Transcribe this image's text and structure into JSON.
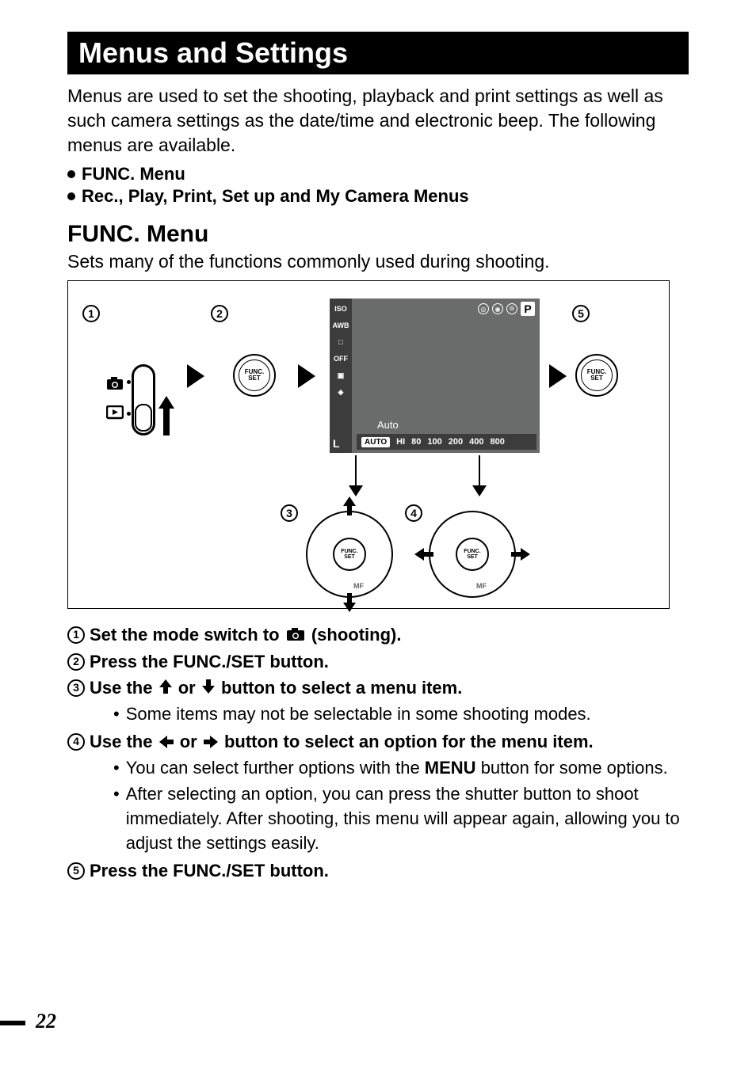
{
  "title": "Menus and Settings",
  "intro": "Menus are used to set the shooting, playback and print settings as well as such camera settings as the date/time and electronic beep. The following menus are available.",
  "bullets": [
    "FUNC. Menu",
    "Rec., Play, Print, Set up and My Camera Menus"
  ],
  "section_title": "FUNC. Menu",
  "section_sub": "Sets many of the functions commonly used during shooting.",
  "diagram": {
    "nums": [
      "1",
      "2",
      "3",
      "4",
      "5"
    ],
    "func_label_top": "FUNC.",
    "func_label_bottom": "SET",
    "screen": {
      "side_items": [
        "ISO",
        "AWB",
        "□",
        "OFF",
        "▣",
        "◈"
      ],
      "side_L": "L",
      "top_icons": [
        "◎",
        "◉",
        "⦾"
      ],
      "p": "P",
      "label": "Auto",
      "bar_auto": "AUTO",
      "bar_vals": [
        "HI",
        "80",
        "100",
        "200",
        "400",
        "800"
      ]
    },
    "dpad_mf": "MF"
  },
  "steps": [
    {
      "n": "1",
      "pre": "Set the mode switch to ",
      "post": " (shooting).",
      "icon": "camera"
    },
    {
      "n": "2",
      "pre": "Press the FUNC./SET button.",
      "post": ""
    },
    {
      "n": "3",
      "pre": "Use the ",
      "mid": "  or  ",
      "post": "  button to select a menu item.",
      "icons": [
        "up",
        "down"
      ],
      "subs": [
        "Some items may not be selectable in some shooting modes."
      ]
    },
    {
      "n": "4",
      "pre": "Use the ",
      "mid": " or ",
      "post": " button to select an option for the menu item.",
      "icons": [
        "left",
        "right"
      ],
      "subs": [
        "You can select further options with the MENU button for some options.",
        "After selecting an option, you can press the shutter button to shoot immediately. After shooting, this menu will appear again, allowing you to adjust the settings easily."
      ]
    },
    {
      "n": "5",
      "pre": "Press the FUNC./SET button.",
      "post": ""
    }
  ],
  "menu_bold": "MENU",
  "page_number": "22"
}
